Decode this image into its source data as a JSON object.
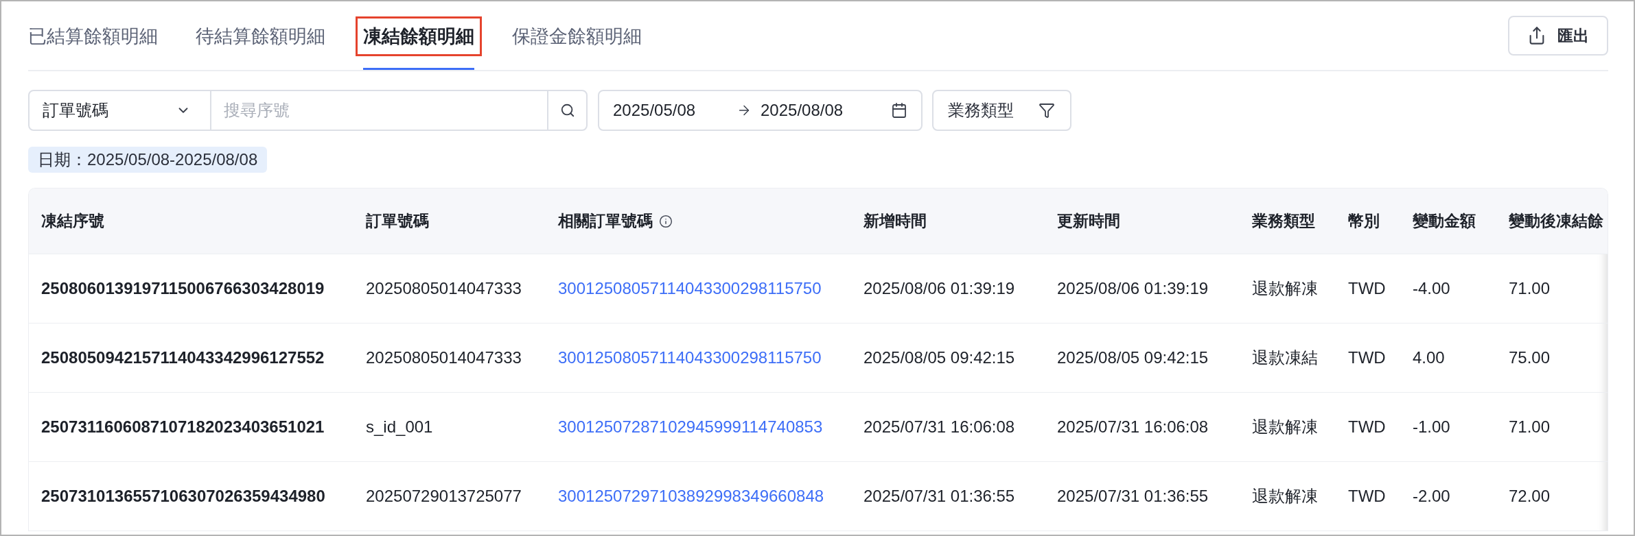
{
  "tabs": [
    {
      "label": "已結算餘額明細",
      "selected": false,
      "highlighted": false
    },
    {
      "label": "待結算餘額明細",
      "selected": false,
      "highlighted": false
    },
    {
      "label": "凍結餘額明細",
      "selected": true,
      "highlighted": true
    },
    {
      "label": "保證金餘額明細",
      "selected": false,
      "highlighted": false
    }
  ],
  "export_button": {
    "label": "匯出"
  },
  "filters": {
    "field_select": {
      "value": "訂單號碼"
    },
    "search": {
      "placeholder": "搜尋序號"
    },
    "date_range": {
      "start": "2025/05/08",
      "end": "2025/08/08"
    },
    "type_filter": {
      "label": "業務類型"
    }
  },
  "applied_tags": [
    {
      "label": "日期：2025/05/08-2025/08/08"
    }
  ],
  "table": {
    "columns": [
      {
        "label": "凍結序號",
        "kind": "serial",
        "info": false
      },
      {
        "label": "訂單號碼",
        "kind": "text",
        "info": false
      },
      {
        "label": "相關訂單號碼",
        "kind": "link",
        "info": true
      },
      {
        "label": "新增時間",
        "kind": "text",
        "info": false
      },
      {
        "label": "更新時間",
        "kind": "text",
        "info": false
      },
      {
        "label": "業務類型",
        "kind": "text",
        "info": false
      },
      {
        "label": "幣別",
        "kind": "text",
        "info": false
      },
      {
        "label": "變動金額",
        "kind": "text",
        "info": false
      },
      {
        "label": "變動後凍結餘",
        "kind": "text",
        "info": false
      }
    ],
    "rows": [
      {
        "cells": [
          "2508060139197115006766303428019",
          "20250805014047333",
          "30012508057114043300298115750",
          "2025/08/06 01:39:19",
          "2025/08/06 01:39:19",
          "退款解凍",
          "TWD",
          "-4.00",
          "71.00"
        ]
      },
      {
        "cells": [
          "2508050942157114043342996127552",
          "20250805014047333",
          "30012508057114043300298115750",
          "2025/08/05 09:42:15",
          "2025/08/05 09:42:15",
          "退款凍結",
          "TWD",
          "4.00",
          "75.00"
        ]
      },
      {
        "cells": [
          "2507311606087107182023403651021",
          "s_id_001",
          "30012507287102945999114740853",
          "2025/07/31 16:06:08",
          "2025/07/31 16:06:08",
          "退款解凍",
          "TWD",
          "-1.00",
          "71.00"
        ]
      },
      {
        "cells": [
          "2507310136557106307026359434980",
          "20250729013725077",
          "30012507297103892998349660848",
          "2025/07/31 01:36:55",
          "2025/07/31 01:36:55",
          "退款解凍",
          "TWD",
          "-2.00",
          "72.00"
        ]
      }
    ]
  }
}
